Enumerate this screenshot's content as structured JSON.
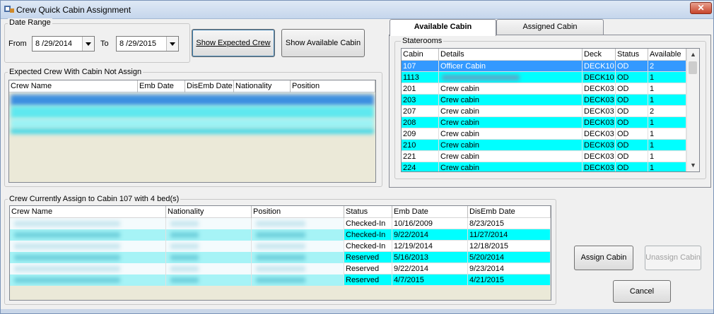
{
  "window": {
    "title": "Crew Quick Cabin Assignment",
    "close_glyph": "✕"
  },
  "date_range": {
    "title": "Date Range",
    "from_label": "From",
    "from_value": "8 /29/2014",
    "to_label": "To",
    "to_value": "8 /29/2015"
  },
  "buttons": {
    "show_expected_crew": "Show Expected Crew",
    "show_available_cabin": "Show Available Cabin",
    "assign_cabin": "Assign Cabin",
    "unassign_cabin": "Unassign Cabin",
    "cancel": "Cancel"
  },
  "expected_crew": {
    "title": "Expected Crew With Cabin Not Assign",
    "columns": [
      "Crew Name",
      "Emb Date",
      "DisEmb Date",
      "Nationality",
      "Position"
    ]
  },
  "tabs": {
    "available": "Available Cabin",
    "assigned": "Assigned Cabin"
  },
  "staterooms": {
    "title": "Staterooms",
    "columns": [
      "Cabin",
      "Details",
      "Deck",
      "Status",
      "Available"
    ],
    "rows": [
      {
        "cabin": "107",
        "details": "Officer Cabin",
        "deck": "DECK10",
        "status": "OD",
        "available": "2",
        "style": "selected"
      },
      {
        "cabin": "1113",
        "details": "",
        "deck": "DECK10",
        "status": "OD",
        "available": "1",
        "style": "cyan",
        "blurred": true
      },
      {
        "cabin": "201",
        "details": "Crew cabin",
        "deck": "DECK03",
        "status": "OD",
        "available": "1",
        "style": "white"
      },
      {
        "cabin": "203",
        "details": "Crew cabin",
        "deck": "DECK03",
        "status": "OD",
        "available": "1",
        "style": "cyan"
      },
      {
        "cabin": "207",
        "details": "Crew cabin",
        "deck": "DECK03",
        "status": "OD",
        "available": "2",
        "style": "white"
      },
      {
        "cabin": "208",
        "details": "Crew cabin",
        "deck": "DECK03",
        "status": "OD",
        "available": "1",
        "style": "cyan"
      },
      {
        "cabin": "209",
        "details": "Crew cabin",
        "deck": "DECK03",
        "status": "OD",
        "available": "1",
        "style": "white"
      },
      {
        "cabin": "210",
        "details": "Crew cabin",
        "deck": "DECK03",
        "status": "OD",
        "available": "1",
        "style": "cyan"
      },
      {
        "cabin": "221",
        "details": "Crew cabin",
        "deck": "DECK03",
        "status": "OD",
        "available": "1",
        "style": "white"
      },
      {
        "cabin": "224",
        "details": "Crew cabin",
        "deck": "DECK03",
        "status": "OD",
        "available": "1",
        "style": "cyan"
      }
    ]
  },
  "current_assign": {
    "title": "Crew Currently Assign to Cabin 107 with 4 bed(s)",
    "columns": [
      "Crew Name",
      "Nationality",
      "Position",
      "Status",
      "Emb Date",
      "DisEmb Date"
    ],
    "rows": [
      {
        "status": "Checked-In",
        "emb": "10/16/2009",
        "disemb": "8/23/2015",
        "style": "white"
      },
      {
        "status": "Checked-In",
        "emb": "9/22/2014",
        "disemb": "11/27/2014",
        "style": "cyan"
      },
      {
        "status": "Checked-In",
        "emb": "12/19/2014",
        "disemb": "12/18/2015",
        "style": "white"
      },
      {
        "status": "Reserved",
        "emb": "5/16/2013",
        "disemb": "5/20/2014",
        "style": "cyan"
      },
      {
        "status": "Reserved",
        "emb": "9/22/2014",
        "disemb": "9/23/2014",
        "style": "white"
      },
      {
        "status": "Reserved",
        "emb": "4/7/2015",
        "disemb": "4/21/2015",
        "style": "cyan"
      }
    ]
  },
  "colors": {
    "cyan": "#00ffff",
    "selected": "#3399ff",
    "white": "#ffffff"
  },
  "icons": {
    "app": "app-icon",
    "dropdown": "chevron-down-icon",
    "scroll_up": "scroll-up-icon",
    "scroll_down": "scroll-down-icon"
  }
}
